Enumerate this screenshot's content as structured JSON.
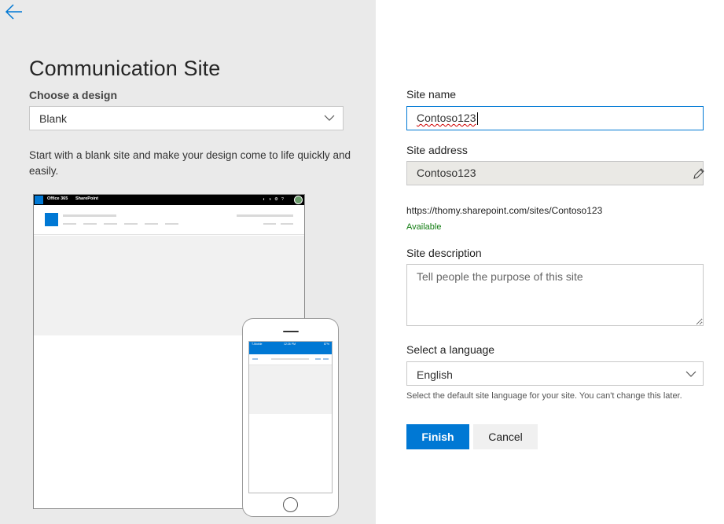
{
  "left_panel": {
    "title": "Communication Site",
    "design_label": "Choose a design",
    "design_selected": "Blank",
    "design_description": "Start with a blank site and make your design come to life quickly and easily.",
    "preview": {
      "desktop_app_name": "Office 365",
      "desktop_product": "SharePoint",
      "phone_carrier": "T-Mobile",
      "phone_time": "12:26 PM",
      "phone_battery": "87%"
    }
  },
  "form": {
    "site_name_label": "Site name",
    "site_name_value": "Contoso123",
    "site_address_label": "Site address",
    "site_address_value": "Contoso123",
    "site_url": "https://thomy.sharepoint.com/sites/Contoso123",
    "availability": "Available",
    "description_label": "Site description",
    "description_placeholder": "Tell people the purpose of this site",
    "language_label": "Select a language",
    "language_selected": "English",
    "language_note": "Select the default site language for your site. You can't change this later.",
    "finish_label": "Finish",
    "cancel_label": "Cancel"
  },
  "colors": {
    "accent": "#0078d4",
    "available_green": "#107c10",
    "left_panel_bg": "#eaeaea"
  },
  "icons": [
    "back-arrow-icon",
    "chevron-down-icon",
    "edit-pencil-icon"
  ]
}
